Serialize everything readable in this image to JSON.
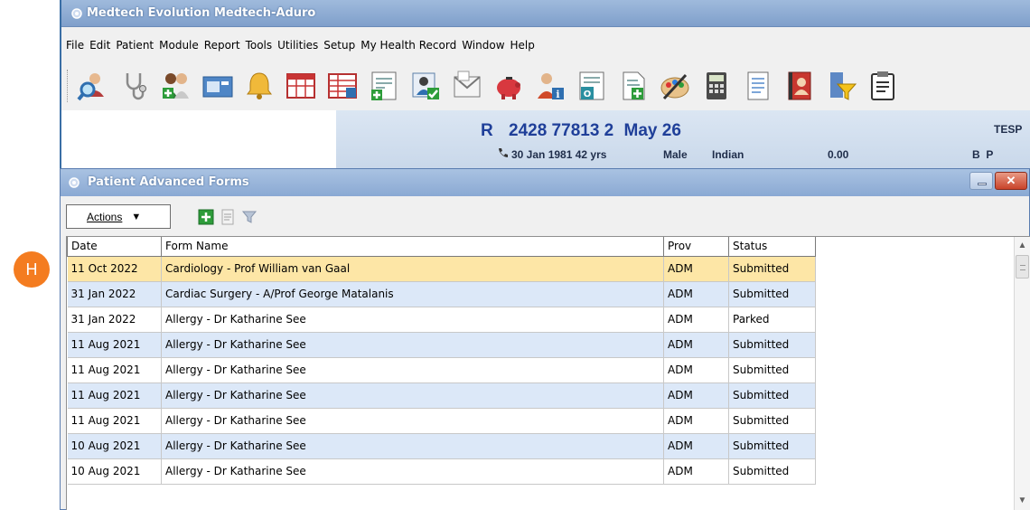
{
  "window": {
    "title": "Medtech Evolution  Medtech-Aduro"
  },
  "menu": [
    "File",
    "Edit",
    "Patient",
    "Module",
    "Report",
    "Tools",
    "Utilities",
    "Setup",
    "My Health Record",
    "Window",
    "Help"
  ],
  "toolbar_icons": [
    "patient-search-icon",
    "stethoscope-icon",
    "patient-register-icon",
    "inbox-icon",
    "bell-icon",
    "appointment-book-icon",
    "daybook-icon",
    "forms-icon",
    "patient-check-icon",
    "letter-icon",
    "piggy-bank-icon",
    "patient-info-icon",
    "outbox-icon",
    "document-add-icon",
    "palette-icon",
    "calculator-icon",
    "notes-icon",
    "address-book-icon",
    "filter-icon",
    "clipboard-icon"
  ],
  "patient": {
    "initial": "R",
    "nhi": "2428 77813 2",
    "label": "May 26",
    "dob_age": "30 Jan 1981 42 yrs",
    "gender": "Male",
    "ethnicity": "Indian",
    "balance": "0.00",
    "tag": "TESP",
    "flags": "B  P"
  },
  "forms_window": {
    "title": "Patient Advanced Forms",
    "actions_label": "Actions",
    "columns": [
      "Date",
      "Form Name",
      "Prov",
      "Status"
    ],
    "rows": [
      {
        "date": "11 Oct 2022",
        "form": "Cardiology - Prof William van Gaal",
        "prov": "ADM",
        "status": "Submitted"
      },
      {
        "date": "31 Jan 2022",
        "form": "Cardiac Surgery - A/Prof George Matalanis",
        "prov": "ADM",
        "status": "Submitted"
      },
      {
        "date": "31 Jan 2022",
        "form": "Allergy - Dr Katharine See",
        "prov": "ADM",
        "status": "Parked"
      },
      {
        "date": "11 Aug 2021",
        "form": "Allergy - Dr Katharine See",
        "prov": "ADM",
        "status": "Submitted"
      },
      {
        "date": "11 Aug 2021",
        "form": "Allergy - Dr Katharine See",
        "prov": "ADM",
        "status": "Submitted"
      },
      {
        "date": "11 Aug 2021",
        "form": "Allergy - Dr Katharine See",
        "prov": "ADM",
        "status": "Submitted"
      },
      {
        "date": "11 Aug 2021",
        "form": "Allergy - Dr Katharine See",
        "prov": "ADM",
        "status": "Submitted"
      },
      {
        "date": "10 Aug 2021",
        "form": "Allergy - Dr Katharine See",
        "prov": "ADM",
        "status": "Submitted"
      },
      {
        "date": "10 Aug 2021",
        "form": "Allergy - Dr Katharine See",
        "prov": "ADM",
        "status": "Submitted"
      }
    ],
    "selected_row": 0
  },
  "callout": {
    "label": "H",
    "color": "#f47c20"
  },
  "colors": {
    "row_selected": "#fde6a6",
    "row_alt": "#dce8f8",
    "name_blue": "#1f3f99",
    "title_bar": "#8aa9d3"
  }
}
